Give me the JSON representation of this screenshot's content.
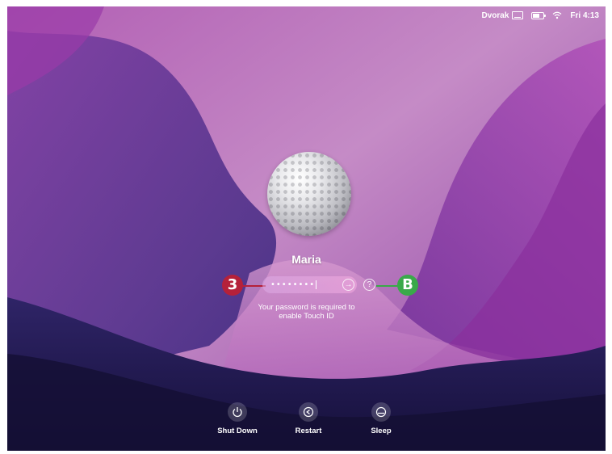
{
  "menubar": {
    "keyboard_layout": "Dvorak",
    "clock": "Fri 4:13"
  },
  "login": {
    "username": "Maria",
    "password_mask": "••••••••",
    "hint_line1": "Your password is required to",
    "hint_line2": "enable Touch ID",
    "help_symbol": "?"
  },
  "callouts": {
    "step": "3",
    "label": "B"
  },
  "controls": {
    "shut_down": "Shut Down",
    "restart": "Restart",
    "sleep": "Sleep"
  },
  "colors": {
    "callout_step": "#b5213a",
    "callout_label": "#3aa94a",
    "wallpaper_primary": "#8e3fa8"
  },
  "icons": [
    "keyboard-icon",
    "battery-icon",
    "wifi-icon",
    "arrow-right-icon",
    "help-icon",
    "power-icon",
    "restart-icon",
    "sleep-icon"
  ]
}
